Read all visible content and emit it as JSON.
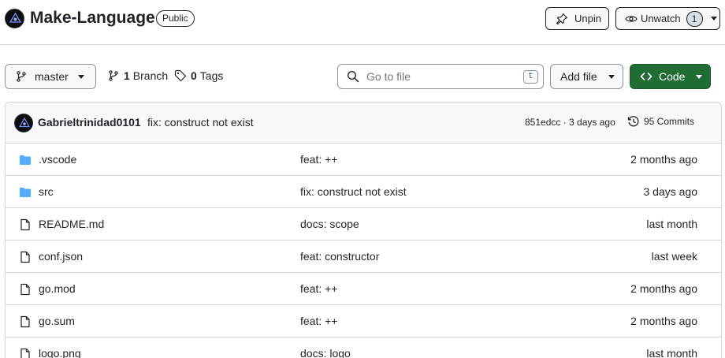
{
  "repo": {
    "name": "Make-Language",
    "visibility": "Public",
    "unpin_label": "Unpin",
    "unwatch_label": "Unwatch",
    "watch_count": "1"
  },
  "toolbar": {
    "branch_name": "master",
    "branch_count": "1",
    "branch_label": "Branch",
    "tag_count": "0",
    "tag_label": "Tags",
    "search_placeholder": "Go to file",
    "search_shortcut": "t",
    "add_file_label": "Add file",
    "code_label": "Code"
  },
  "latest_commit": {
    "author": "Gabrieltrinidad0101",
    "message": "fix: construct not exist",
    "meta": "851edcc · 3 days ago",
    "commits_label": "95 Commits"
  },
  "files": [
    {
      "name": ".vscode",
      "type": "folder",
      "commit": "feat: ++",
      "age": "2 months ago"
    },
    {
      "name": "src",
      "type": "folder",
      "commit": "fix: construct not exist",
      "age": "3 days ago"
    },
    {
      "name": "README.md",
      "type": "file",
      "commit": "docs: scope",
      "age": "last month"
    },
    {
      "name": "conf.json",
      "type": "file",
      "commit": "feat: constructor",
      "age": "last week"
    },
    {
      "name": "go.mod",
      "type": "file",
      "commit": "feat: ++",
      "age": "2 months ago"
    },
    {
      "name": "go.sum",
      "type": "file",
      "commit": "feat: ++",
      "age": "2 months ago"
    },
    {
      "name": "logo.png",
      "type": "file",
      "commit": "docs: logo",
      "age": "last month"
    }
  ],
  "colors": {
    "accent": "#1f6d33",
    "folder": "#54aeff",
    "border": "#d0d7de"
  }
}
